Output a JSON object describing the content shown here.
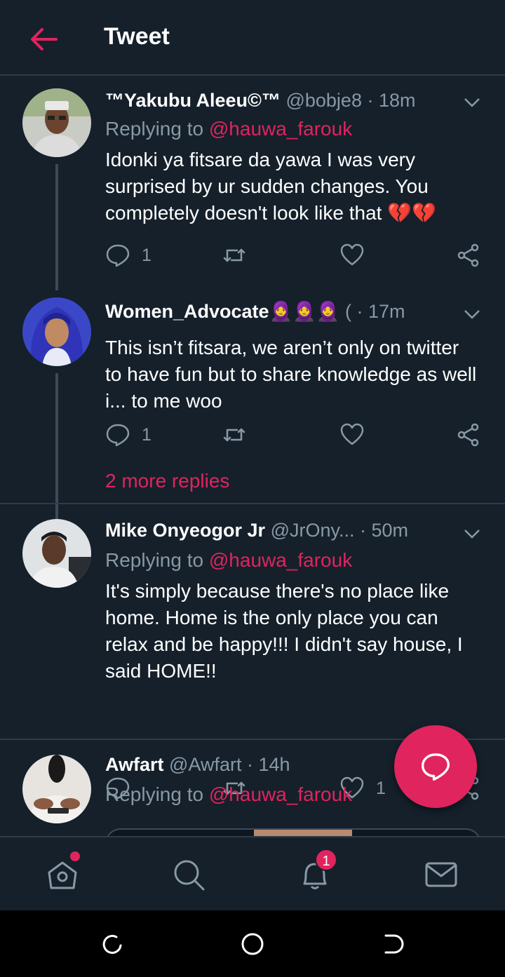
{
  "header": {
    "title": "Tweet"
  },
  "tweets": [
    {
      "name": "™Yakubu Aleeu©™",
      "handle": "@bobje8",
      "time": "· 18m",
      "replying_prefix": "Replying to ",
      "replying_handle": "@hauwa_farouk",
      "text": "Idonki ya fitsare da yawa I was very surprised by ur sudden changes. You completely doesn't look like that 💔💔",
      "reply_count": "1",
      "retweet_count": "",
      "like_count": ""
    },
    {
      "name": "Women_Advocate🧕🧕🧕",
      "handle": "(",
      "time": "· 17m",
      "text": "This isn’t fitsara, we aren’t only on twitter to have fun but to share knowledge as well i... to me woo",
      "reply_count": "1",
      "retweet_count": "",
      "like_count": "",
      "more_replies": "2 more replies"
    },
    {
      "name": "Mike Onyeogor Jr",
      "handle": "@JrOny...",
      "time": "· 50m",
      "replying_prefix": "Replying to ",
      "replying_handle": "@hauwa_farouk",
      "text": "It's simply because there's no place like home. Home is the only place you can relax and be happy!!! I didn't say house, I said HOME!!",
      "reply_count": "",
      "retweet_count": "",
      "like_count": "1"
    },
    {
      "name": "Awfart",
      "handle": "@Awfart",
      "time": "· 14h",
      "replying_prefix": "Replying to ",
      "replying_handle": "@hauwa_farouk"
    }
  ],
  "bottom_nav": {
    "notifications_badge": "1"
  },
  "colors": {
    "background": "#15202b",
    "accent": "#e0245e",
    "muted": "#8899a6",
    "divider": "#2f3b47"
  },
  "icons": [
    "back-arrow-icon",
    "chevron-down-icon",
    "reply-icon",
    "retweet-icon",
    "like-icon",
    "share-icon",
    "compose-reply-icon",
    "home-icon",
    "search-icon",
    "notifications-icon",
    "messages-icon"
  ]
}
